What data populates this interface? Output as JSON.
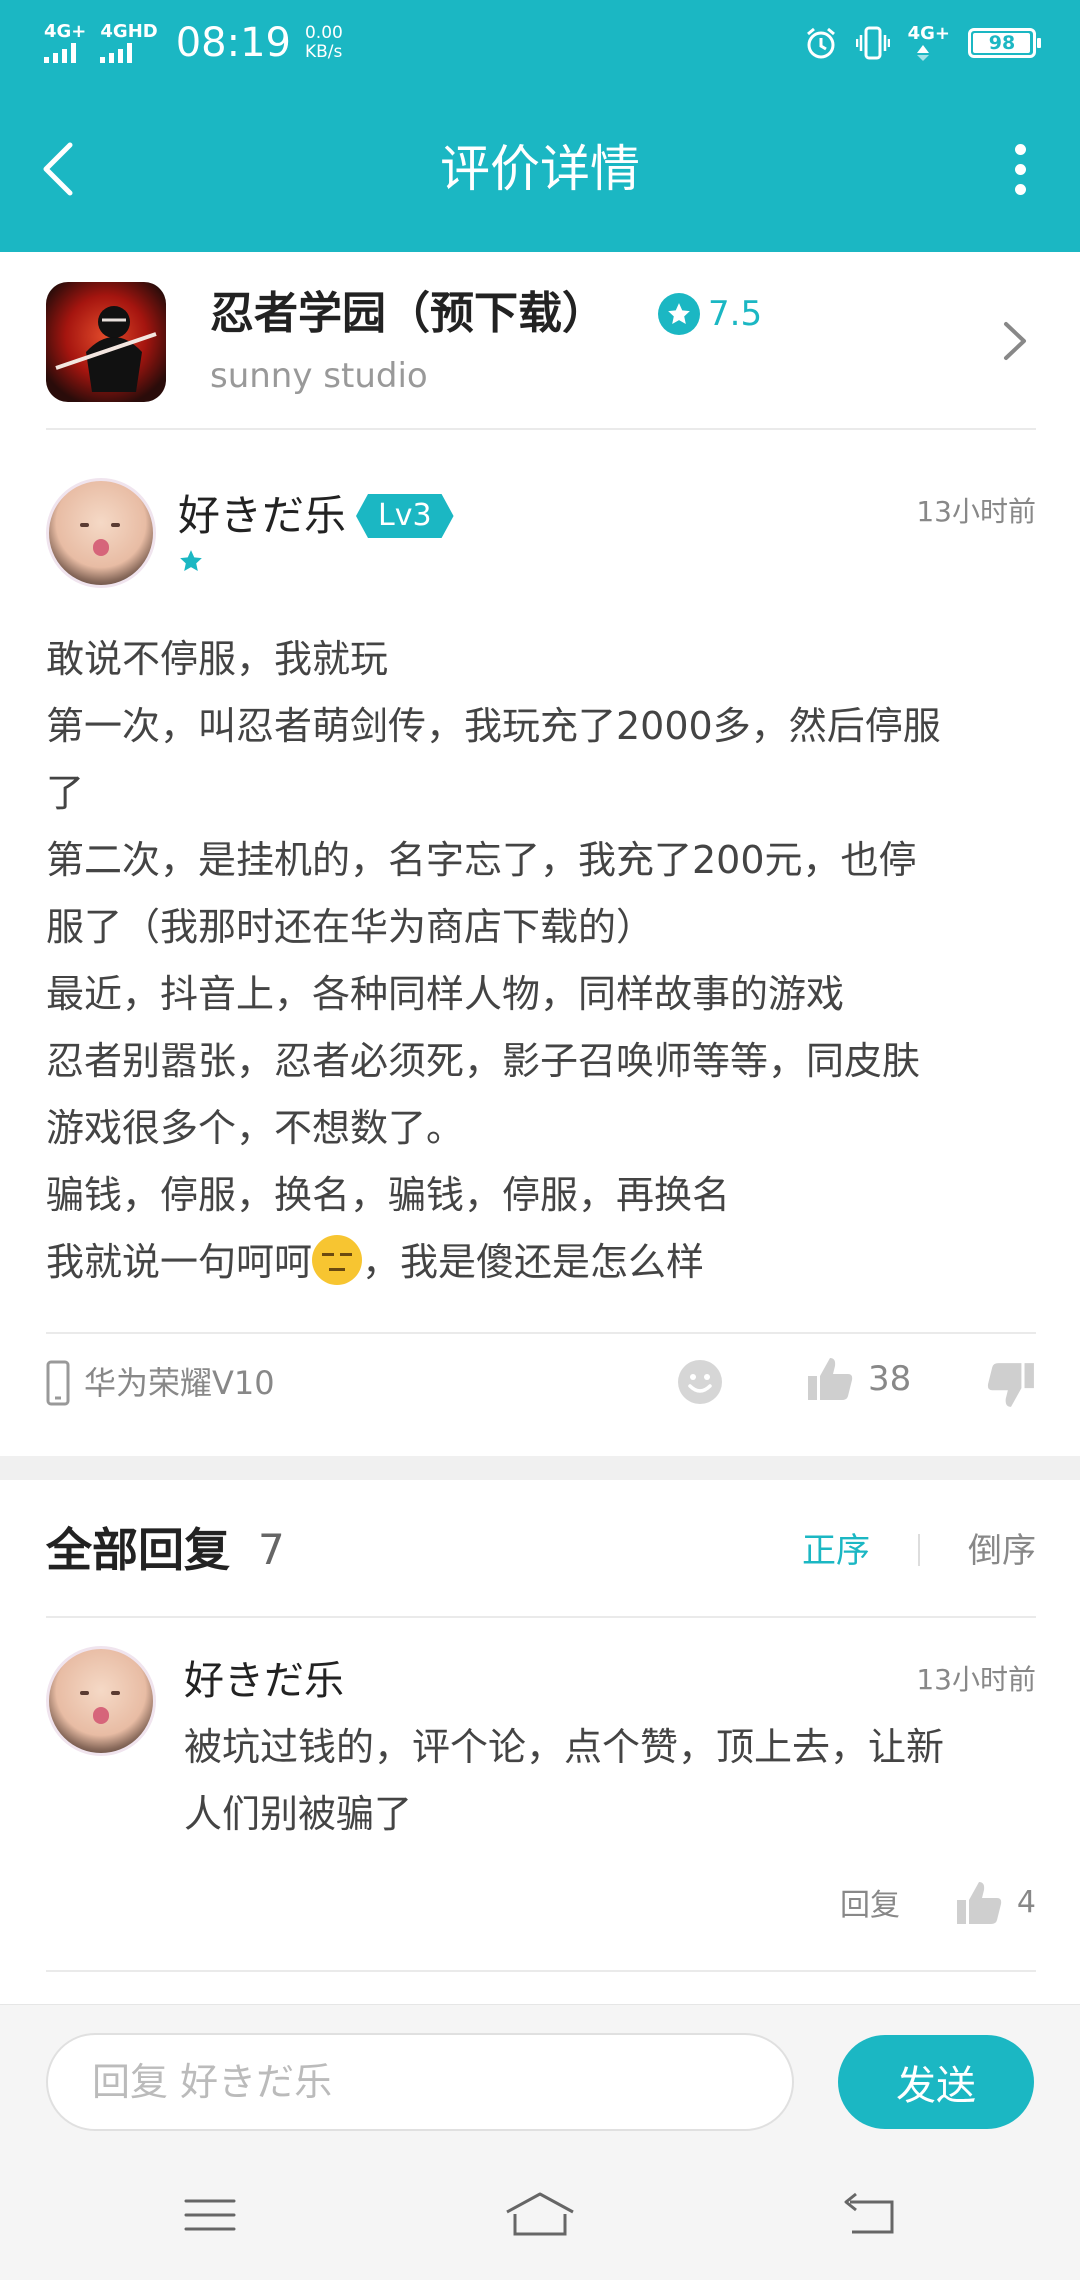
{
  "status_bar": {
    "signal1": "4G+",
    "signal2": "4GHD",
    "time": "08:19",
    "speed_value": "0.00",
    "speed_unit": "KB/s",
    "data_indicator": "4G+",
    "battery_level": "98"
  },
  "header": {
    "title": "评价详情"
  },
  "app": {
    "name": "忍者学园（预下载）",
    "rating": "7.5",
    "developer": "sunny studio"
  },
  "review": {
    "username": "好きだ乐",
    "level": "Lv3",
    "stars": 1,
    "time": "13小时前",
    "lines": [
      "敢说不停服，我就玩",
      "第一次，叫忍者萌剑传，我玩充了2000多，然后停服",
      "了",
      "第二次，是挂机的，名字忘了，我充了200元，也停",
      "服了（我那时还在华为商店下载的）",
      "最近，抖音上，各种同样人物，同样故事的游戏",
      "忍者别嚣张，忍者必须死，影子召唤师等等，同皮肤",
      "游戏很多个，不想数了。",
      "骗钱，停服，换名，骗钱，停服，再换名"
    ],
    "last_line_before": "我就说一句呵呵",
    "last_line_after": "，我是傻还是怎么样",
    "device": "华为荣耀V10",
    "likes": "38"
  },
  "replies": {
    "title": "全部回复",
    "count": "7",
    "sort_asc": "正序",
    "sort_desc": "倒序",
    "items": [
      {
        "username": "好きだ乐",
        "time": "13小时前",
        "lines": [
          "被坑过钱的，评个论，点个赞，顶上去，让新",
          "人们别被骗了"
        ],
        "reply_label": "回复",
        "likes": "4"
      }
    ]
  },
  "input": {
    "placeholder": "回复 好きだ乐",
    "send_label": "发送"
  },
  "colors": {
    "accent": "#1bb7c3",
    "text": "#444444",
    "muted": "#888888"
  }
}
